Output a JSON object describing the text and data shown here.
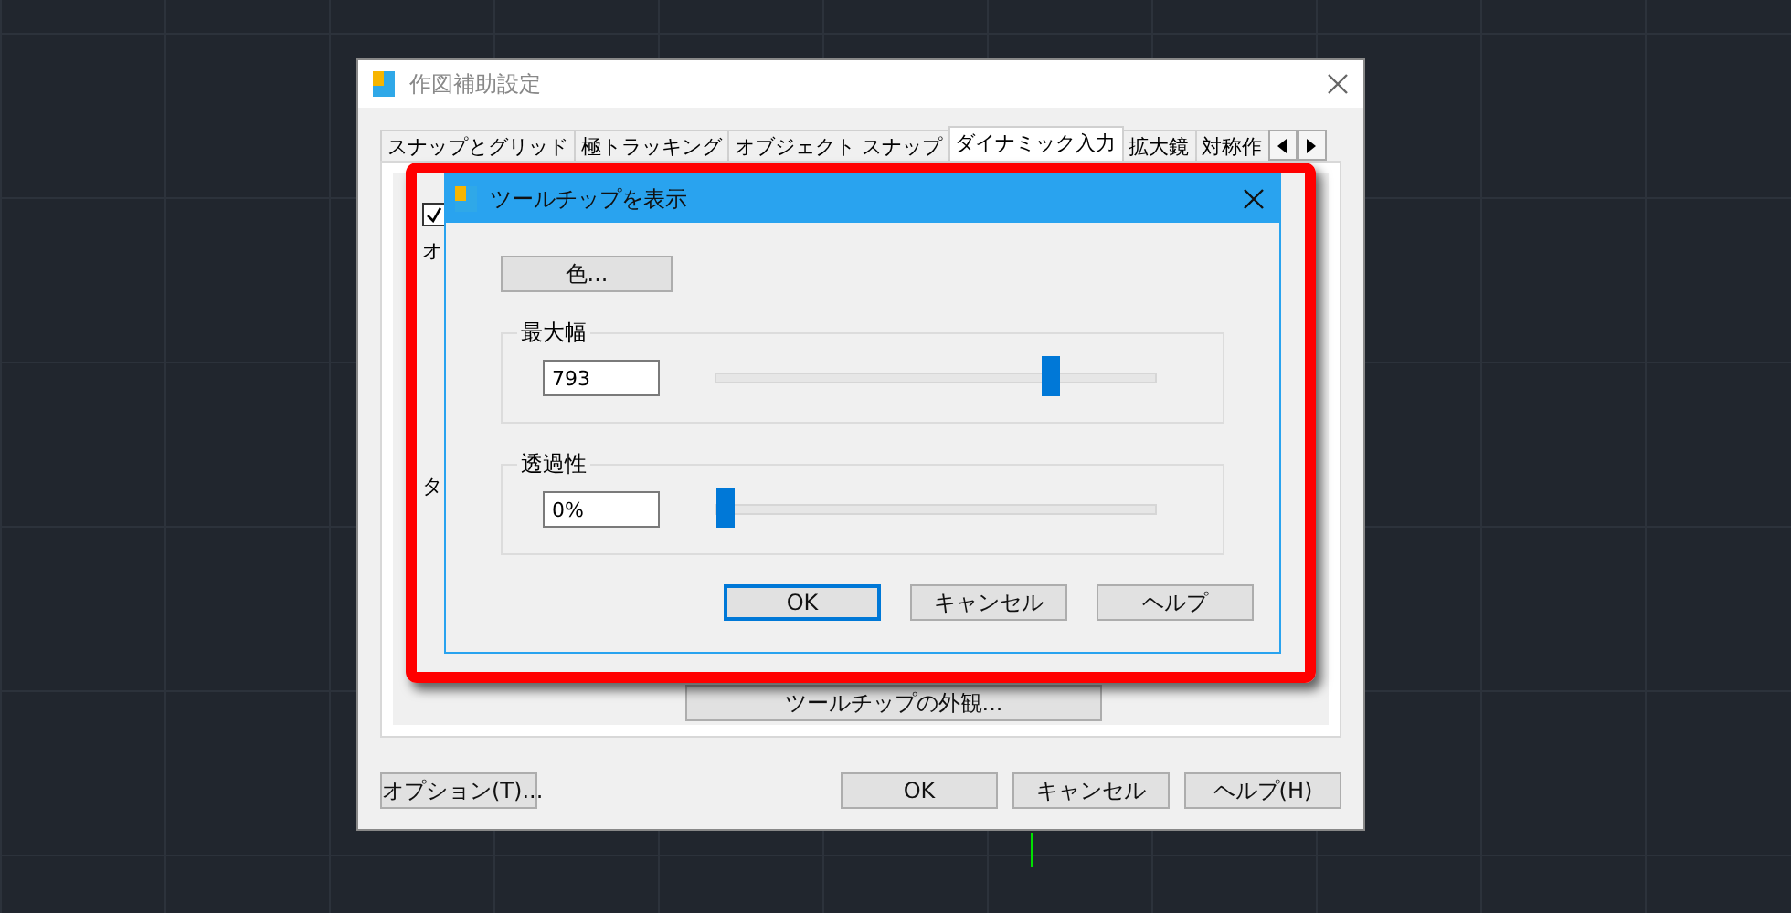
{
  "window": {
    "title": "作図補助設定"
  },
  "tabs": [
    {
      "label": "スナップとグリッド",
      "selected": false
    },
    {
      "label": "極トラッキング",
      "selected": false
    },
    {
      "label": "オブジェクト スナップ",
      "selected": false
    },
    {
      "label": "ダイナミック入力",
      "selected": true
    },
    {
      "label": "拡大鏡",
      "selected": false
    },
    {
      "label": "対称作",
      "selected": false
    }
  ],
  "panel": {
    "checkbox": {
      "checked": true
    },
    "label_1": "オ",
    "label_2": "タ",
    "appearance_button": "ツールチップの外観..."
  },
  "options_button": "オプション(T)...",
  "buttons": [
    "OK",
    "キャンセル",
    "ヘルプ(H)"
  ],
  "tooltip_dialog": {
    "title": "ツールチップを表示",
    "color_button": "色...",
    "groups": [
      {
        "label": "最大幅",
        "value": "793",
        "level": 0.74
      },
      {
        "label": "透過性",
        "value": "0%",
        "level": 0
      }
    ],
    "buttons": [
      {
        "label": "OK",
        "selected": true
      },
      {
        "label": "キャンセル",
        "selected": false
      },
      {
        "label": "ヘルプ",
        "selected": false
      }
    ]
  }
}
